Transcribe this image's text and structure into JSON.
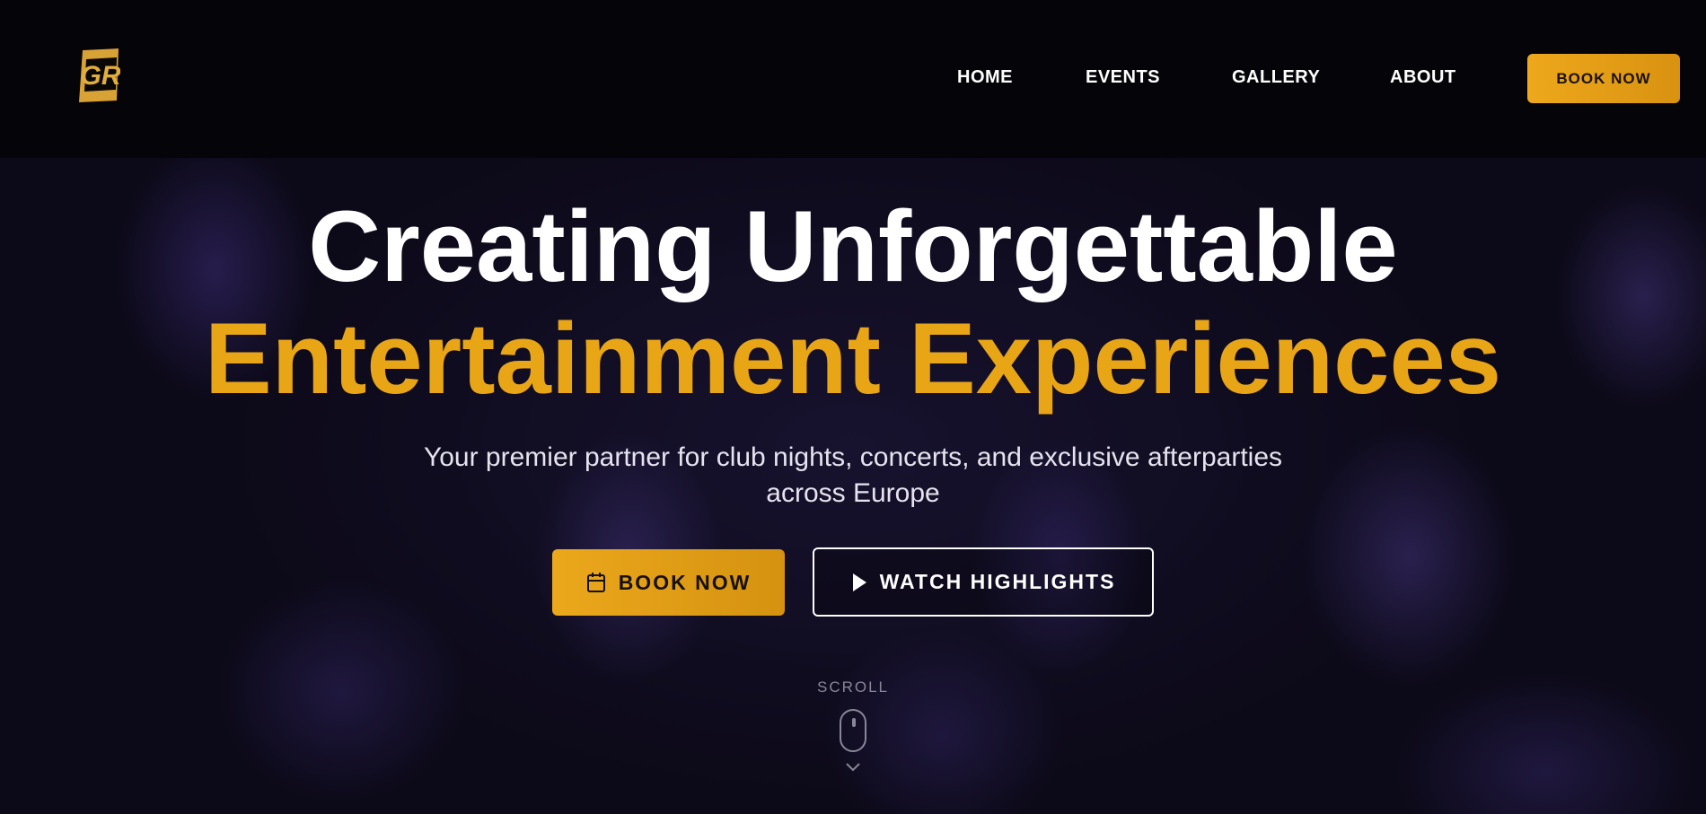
{
  "header": {
    "logo_text": "GR",
    "nav": {
      "home": "HOME",
      "events": "EVENTS",
      "gallery": "GALLERY",
      "about": "ABOUT"
    },
    "book_label": "BOOK NOW"
  },
  "hero": {
    "title_line1": "Creating Unforgettable",
    "title_line2": "Entertainment Experiences",
    "subtitle": "Your premier partner for club nights, concerts, and exclusive afterparties across Europe",
    "book_button": "BOOK NOW",
    "watch_button": "WATCH HIGHLIGHTS",
    "scroll_label": "SCROLL"
  },
  "icons": {
    "calendar": "calendar-icon",
    "play": "play-icon",
    "mouse": "mouse-icon",
    "chevron": "chevron-down-icon"
  },
  "colors": {
    "accent": "#e8a516",
    "background": "#0d0a1c",
    "header_bg": "#050408"
  }
}
